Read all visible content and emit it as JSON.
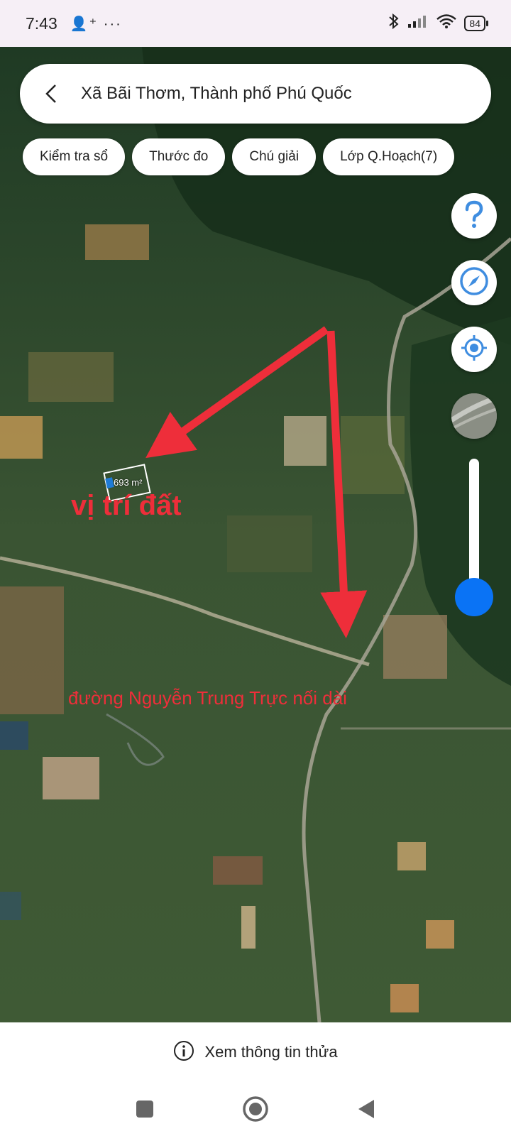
{
  "status_bar": {
    "time": "7:43",
    "extra_icons": "👤⁺ ···",
    "battery": "84"
  },
  "search": {
    "title": "Xã Bãi Thơm, Thành phố Phú Quốc"
  },
  "chips": [
    {
      "label": "Kiểm tra sổ"
    },
    {
      "label": "Thước đo"
    },
    {
      "label": "Chú giải"
    },
    {
      "label": "Lớp Q.Hoạch(7)"
    }
  ],
  "map_controls": {
    "help_icon": "question-icon",
    "compass_icon": "compass-icon",
    "locate_icon": "my-location-icon",
    "layer_icon": "map-layer-icon",
    "zoom_level": 0.1
  },
  "map": {
    "parcel_area": "693 m²",
    "annotation_location": "vị trí đất",
    "annotation_road": "đường Nguyễn Trung Trực nối dài",
    "annotation_color": "#ee2e3a"
  },
  "info_bar": {
    "label": "Xem thông tin thửa"
  },
  "accent_color": "#0a73f5"
}
